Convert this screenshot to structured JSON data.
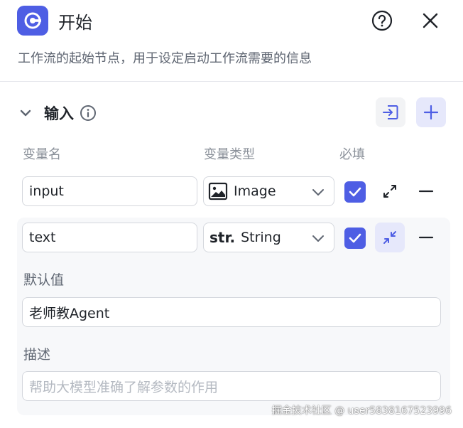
{
  "header": {
    "title": "开始",
    "description": "工作流的起始节点，用于设定启动工作流需要的信息"
  },
  "section": {
    "title": "输入"
  },
  "columns": {
    "name": "变量名",
    "type": "变量类型",
    "required": "必填"
  },
  "variables": [
    {
      "name": "input",
      "type": "Image",
      "required": true
    },
    {
      "name": "text",
      "type": "String",
      "type_prefix": "str.",
      "required": true
    }
  ],
  "detail": {
    "default_label": "默认值",
    "default_value": "老师教Agent",
    "description_label": "描述",
    "description_placeholder": "帮助大模型准确了解参数的作用"
  },
  "watermark": "掘金技术社区 @ user5838167523996",
  "colors": {
    "accent": "#4e5ee4",
    "accent_soft": "#e6e8fb",
    "text": "#1f2329",
    "muted": "#8a9099"
  }
}
